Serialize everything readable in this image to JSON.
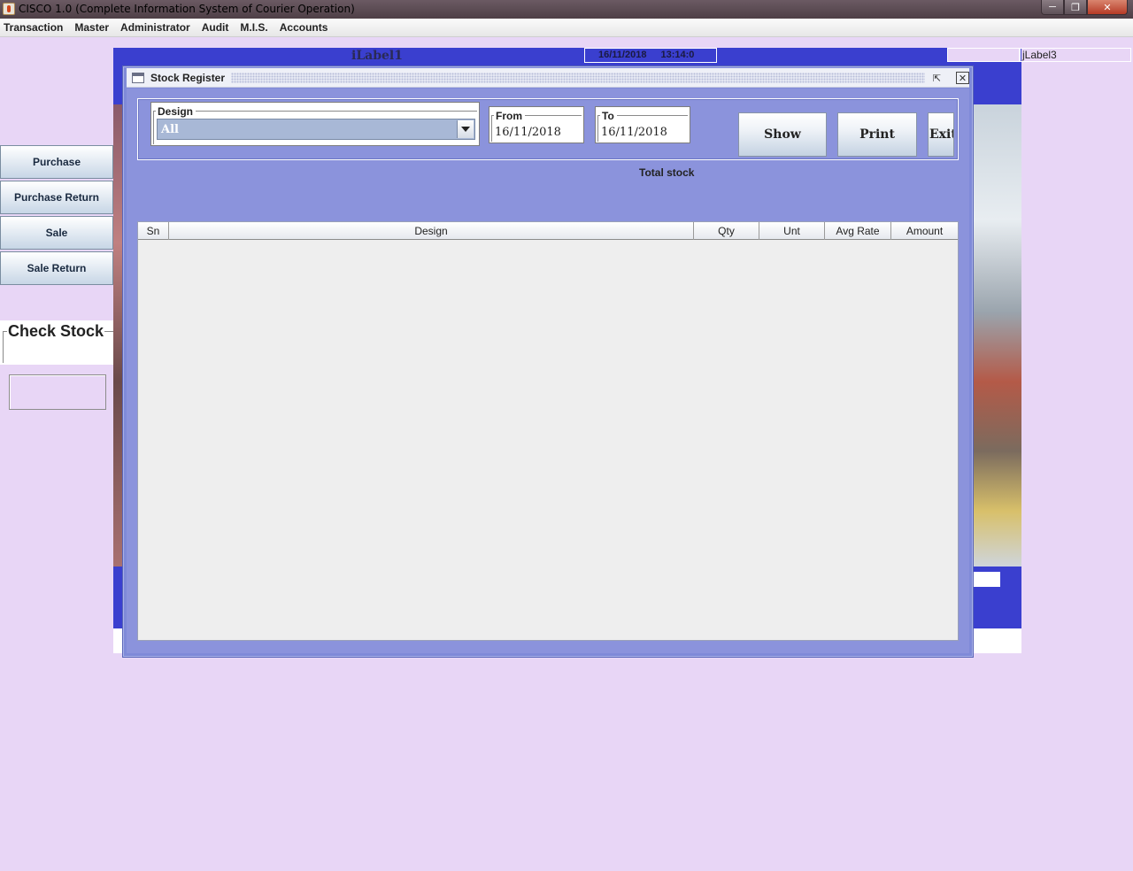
{
  "window": {
    "title": "CISCO 1.0 (Complete Information System of Courier Operation)"
  },
  "menubar": {
    "items": [
      "Transaction",
      "Master",
      "Administrator",
      "Audit",
      "M.I.S.",
      "Accounts"
    ]
  },
  "background": {
    "label1": "iLabel1",
    "date": "16/11/2018",
    "time": "13:14:0",
    "label3": "jLabel3"
  },
  "sidebar": {
    "buttons": [
      "Purchase",
      "Purchase Return",
      "Sale",
      "Sale Return"
    ],
    "check_stock_title": "Check Stock"
  },
  "stock_register": {
    "title": "Stock Register",
    "design_label": "Design",
    "design_value": "All",
    "from_label": "From",
    "from_value": "16/11/2018",
    "to_label": "To",
    "to_value": "16/11/2018",
    "show_label": "Show",
    "print_label": "Print",
    "exit_label": "Exit",
    "total_stock_label": "Total stock",
    "columns": [
      "Sn",
      "Design",
      "Qty",
      "Unt",
      "Avg Rate",
      "Amount"
    ]
  },
  "colors": {
    "desktop": "#e8d6f6",
    "frame": "#8b93dc",
    "panel_blue": "#3a3fcf"
  }
}
